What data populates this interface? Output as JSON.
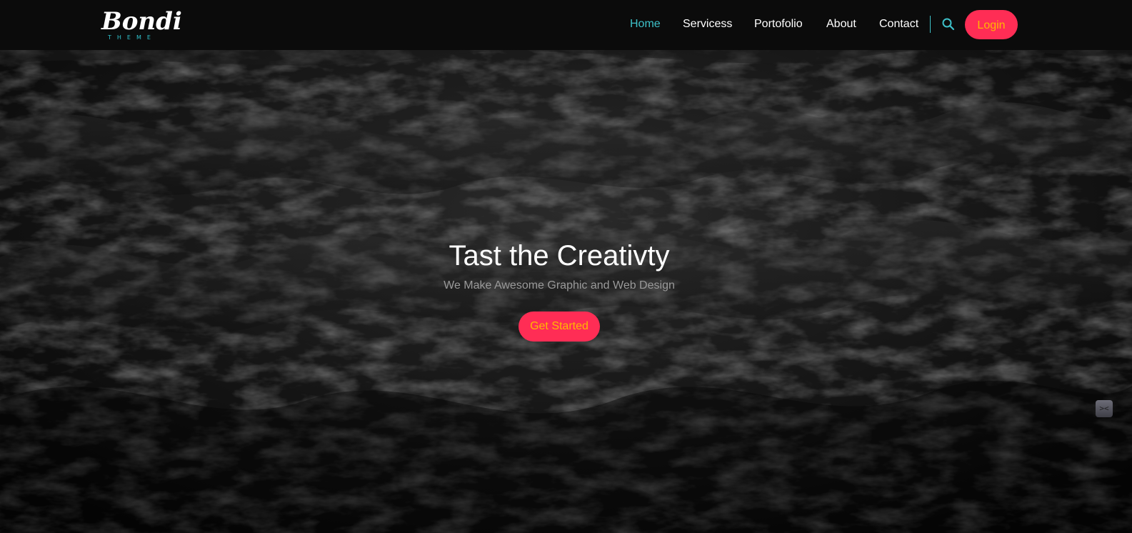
{
  "brand": {
    "logo_script": "Bondi",
    "logo_sub": "THEME",
    "accent_color": "#3ec1c9",
    "primary_button_color": "#ff2d55",
    "button_text_color": "#ffb800"
  },
  "nav": {
    "items": [
      {
        "label": "Home",
        "active": true
      },
      {
        "label": "Servicess",
        "active": false
      },
      {
        "label": "Portofolio",
        "active": false
      },
      {
        "label": "About",
        "active": false
      },
      {
        "label": "Contact",
        "active": false
      }
    ],
    "search_icon": "search-icon",
    "login_label": "Login"
  },
  "hero": {
    "title": "Tast the Creativty",
    "subtitle": "We Make Awesome Graphic and Web Design",
    "cta_label": "Get Started",
    "background": "dark-waves"
  },
  "side_widget": {
    "icon": "emoji-face-icon",
    "glyph": "><"
  }
}
